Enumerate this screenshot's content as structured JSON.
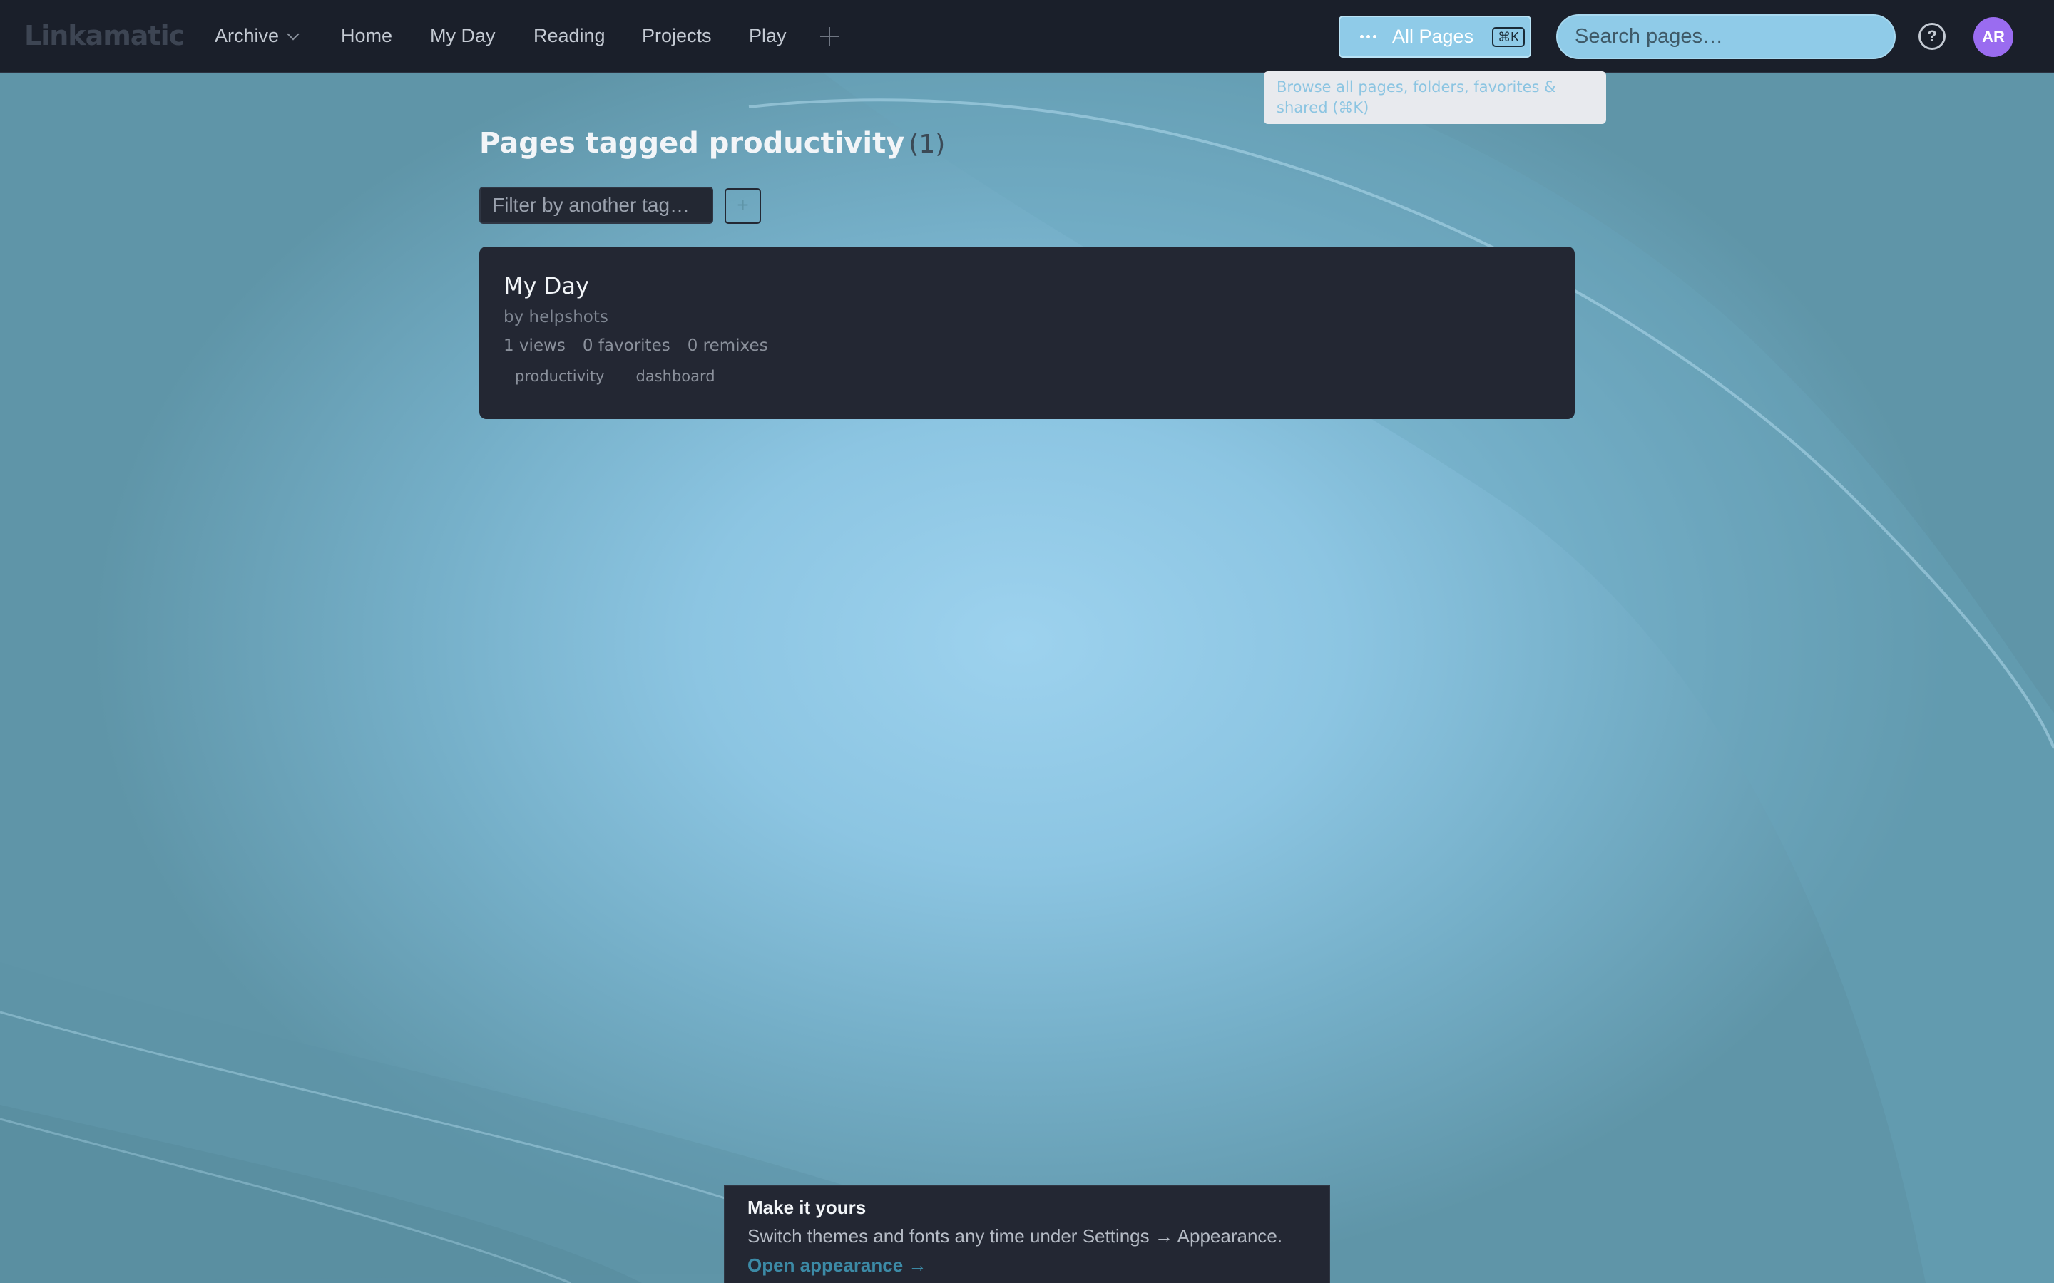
{
  "app": {
    "logo": "Linkamatic"
  },
  "nav": {
    "archive_label": "Archive",
    "items": [
      {
        "label": "Home"
      },
      {
        "label": "My Day"
      },
      {
        "label": "Reading"
      },
      {
        "label": "Projects"
      },
      {
        "label": "Play"
      }
    ]
  },
  "toolbar": {
    "all_pages_label": "All Pages",
    "all_pages_shortcut": "⌘K",
    "search_placeholder": "Search pages…",
    "help_symbol": "?",
    "avatar_initials": "AR"
  },
  "tooltip": {
    "text": "Browse all pages, folders, favorites & shared (⌘K)"
  },
  "main": {
    "title": "Pages tagged productivity",
    "count": "(1)",
    "filter_placeholder": "Filter by another tag…",
    "filter_add_symbol": "+"
  },
  "results": [
    {
      "title": "My Day",
      "author": "by helpshots",
      "views": "1 views",
      "favorites": "0 favorites",
      "remixes": "0 remixes",
      "tags": [
        "productivity",
        "dashboard"
      ]
    }
  ],
  "toast": {
    "title": "Make it yours",
    "body": "Switch themes and fonts any time under Settings → Appearance.",
    "link": "Open appearance →"
  },
  "colors": {
    "topbar_bg": "#1a1f2a",
    "accent": "#8fcbe8",
    "card_bg": "#232733",
    "avatar": "#9a6cf0",
    "link": "#3c8aa6"
  }
}
